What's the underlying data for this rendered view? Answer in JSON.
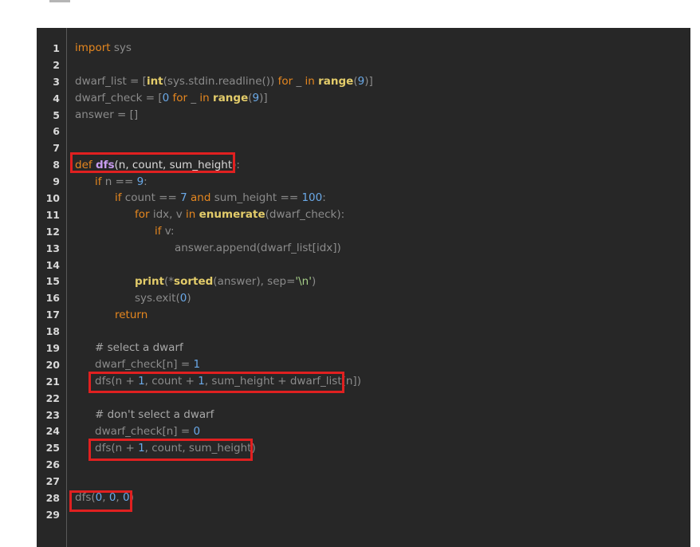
{
  "editor": {
    "lines": [
      {
        "n": "1"
      },
      {
        "n": "2"
      },
      {
        "n": "3"
      },
      {
        "n": "4"
      },
      {
        "n": "5"
      },
      {
        "n": "6"
      },
      {
        "n": "7"
      },
      {
        "n": "8"
      },
      {
        "n": "9"
      },
      {
        "n": "10"
      },
      {
        "n": "11"
      },
      {
        "n": "12"
      },
      {
        "n": "13"
      },
      {
        "n": "14"
      },
      {
        "n": "15"
      },
      {
        "n": "16"
      },
      {
        "n": "17"
      },
      {
        "n": "18"
      },
      {
        "n": "19"
      },
      {
        "n": "20"
      },
      {
        "n": "21"
      },
      {
        "n": "22"
      },
      {
        "n": "23"
      },
      {
        "n": "24"
      },
      {
        "n": "25"
      },
      {
        "n": "26"
      },
      {
        "n": "27"
      },
      {
        "n": "28"
      },
      {
        "n": "29"
      }
    ],
    "tokens": {
      "l1_import": "import",
      "l1_sys": " sys",
      "l3_a": "dwarf_list = [",
      "l3_int": "int",
      "l3_b": "(sys.stdin.readline()) ",
      "l3_for": "for",
      "l3_c": " _ ",
      "l3_in": "in",
      "l3_d": " ",
      "l3_range": "range",
      "l3_e": "(",
      "l3_9": "9",
      "l3_f": ")]",
      "l4_a": "dwarf_check = [",
      "l4_0": "0",
      "l4_b": " ",
      "l4_for": "for",
      "l4_c": " _ ",
      "l4_in": "in",
      "l4_d": " ",
      "l4_range": "range",
      "l4_e": "(",
      "l4_9": "9",
      "l4_f": ")]",
      "l5": "answer = []",
      "l8_def": "def",
      "l8_sp": " ",
      "l8_dfs": "dfs",
      "l8_args": "(n, count, sum_height)",
      "l8_colon": ":",
      "l9_if": "if",
      "l9_a": " n == ",
      "l9_9": "9",
      "l9_b": ":",
      "l10_if": "if",
      "l10_a": " count == ",
      "l10_7": "7",
      "l10_sp": " ",
      "l10_and": "and",
      "l10_b": " sum_height == ",
      "l10_100": "100",
      "l10_c": ":",
      "l11_for": "for",
      "l11_a": " idx, v ",
      "l11_in": "in",
      "l11_sp": " ",
      "l11_enum": "enumerate",
      "l11_b": "(dwarf_check):",
      "l12_if": "if",
      "l12_a": " v:",
      "l13": "answer.append(dwarf_list[idx])",
      "l15_print": "print",
      "l15_a": "(*",
      "l15_sorted": "sorted",
      "l15_b": "(answer), sep=",
      "l15_str": "'\\n'",
      "l15_c": ")",
      "l16_a": "sys.exit(",
      "l16_0": "0",
      "l16_b": ")",
      "l17_return": "return",
      "l19": "# select a dwarf",
      "l20_a": "dwarf_check[n] = ",
      "l20_1": "1",
      "l21_a": "dfs(n + ",
      "l21_1a": "1",
      "l21_b": ", count + ",
      "l21_1b": "1",
      "l21_c": ", sum_height + dwarf_list[n])",
      "l23": "# don't select a dwarf",
      "l24_a": "dwarf_check[n] = ",
      "l24_0": "0",
      "l25_a": "dfs(n + ",
      "l25_1": "1",
      "l25_b": ", count, sum_height)",
      "l28_a": "dfs(",
      "l28_0a": "0",
      "l28_b": ", ",
      "l28_0b": "0",
      "l28_c": ", ",
      "l28_0c": "0",
      "l28_d": ")"
    }
  },
  "colors": {
    "background": "#272727",
    "keyword": "#e6871f",
    "builtin": "#e3cc6a",
    "number": "#6aa9e8",
    "function_name": "#c79cf0",
    "highlight_box": "#e02020"
  }
}
